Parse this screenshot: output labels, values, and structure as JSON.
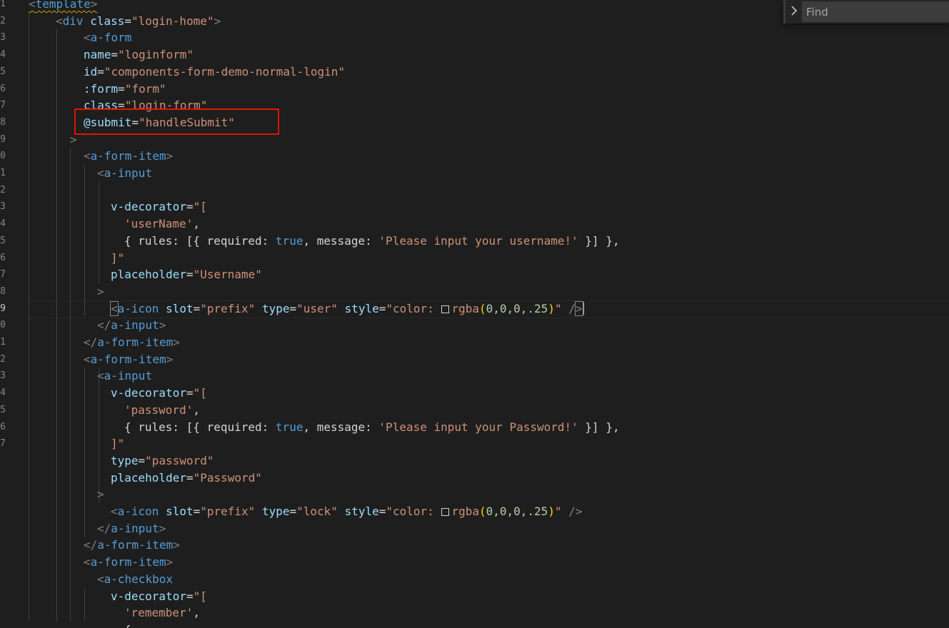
{
  "editor": {
    "gutter_numbers": [
      "1",
      "2",
      "3",
      "4",
      "5",
      "6",
      "7",
      "8",
      "9",
      "0",
      "1",
      "2",
      "3",
      "4",
      "5",
      "6",
      "7",
      "8",
      "9",
      "0",
      "1",
      "2",
      "3",
      "4",
      "5",
      "6",
      "7"
    ],
    "active_line_index": 18
  },
  "find_widget": {
    "placeholder": "Find",
    "toggle_icon": "chevron-right-icon"
  },
  "highlight": {
    "color": "#e51400",
    "target_line_index": 7
  },
  "code_lines": [
    [
      [
        "t-punc squiggle",
        "<"
      ],
      [
        "t-tag squiggle",
        "template"
      ],
      [
        "t-punc squiggle",
        ">"
      ]
    ],
    [
      [
        "t-punc",
        "<"
      ],
      [
        "t-tag",
        "div"
      ],
      [
        "t-txt",
        " "
      ],
      [
        "t-attr",
        "class"
      ],
      [
        "t-txt",
        "="
      ],
      [
        "t-str",
        "\"login-home\""
      ],
      [
        "t-punc",
        ">"
      ]
    ],
    [
      [
        "t-punc",
        "<"
      ],
      [
        "t-tag",
        "a-form"
      ]
    ],
    [
      [
        "t-attr",
        "name"
      ],
      [
        "t-txt",
        "="
      ],
      [
        "t-str",
        "\"loginform\""
      ]
    ],
    [
      [
        "t-attr",
        "id"
      ],
      [
        "t-txt",
        "="
      ],
      [
        "t-str",
        "\"components-form-demo-normal-login\""
      ]
    ],
    [
      [
        "t-attr",
        ":form"
      ],
      [
        "t-txt",
        "="
      ],
      [
        "t-str",
        "\"form\""
      ]
    ],
    [
      [
        "t-attr",
        "class"
      ],
      [
        "t-txt",
        "="
      ],
      [
        "t-str",
        "\"login-form\""
      ]
    ],
    [
      [
        "t-attr",
        "@submit"
      ],
      [
        "t-txt",
        "="
      ],
      [
        "t-str",
        "\"handleSubmit\""
      ]
    ],
    [
      [
        "t-punc",
        ">"
      ]
    ],
    [
      [
        "t-punc",
        "<"
      ],
      [
        "t-tag",
        "a-form-item"
      ],
      [
        "t-punc",
        ">"
      ]
    ],
    [
      [
        "t-punc",
        "<"
      ],
      [
        "t-tag",
        "a-input"
      ]
    ],
    [],
    [
      [
        "t-attr",
        "v-decorator"
      ],
      [
        "t-txt",
        "="
      ],
      [
        "t-str",
        "\"["
      ]
    ],
    [
      [
        "t-str",
        "'userName'"
      ],
      [
        "t-txt",
        ","
      ]
    ],
    [
      [
        "t-txt",
        "{ rules: [{ required: "
      ],
      [
        "t-bool",
        "true"
      ],
      [
        "t-txt",
        ", message: "
      ],
      [
        "t-str",
        "'Please input your username!'"
      ],
      [
        "t-txt",
        " }] },"
      ]
    ],
    [
      [
        "t-str",
        "]\""
      ]
    ],
    [
      [
        "t-attr",
        "placeholder"
      ],
      [
        "t-txt",
        "="
      ],
      [
        "t-str",
        "\"Username\""
      ]
    ],
    [
      [
        "t-punc",
        ">"
      ]
    ],
    [
      [
        "t-punc bracket-match",
        "<"
      ],
      [
        "t-tag",
        "a-icon"
      ],
      [
        "t-txt",
        " "
      ],
      [
        "t-attr",
        "slot"
      ],
      [
        "t-txt",
        "="
      ],
      [
        "t-str",
        "\"prefix\""
      ],
      [
        "t-txt",
        " "
      ],
      [
        "t-attr",
        "type"
      ],
      [
        "t-txt",
        "="
      ],
      [
        "t-str",
        "\"user\""
      ],
      [
        "t-txt",
        " "
      ],
      [
        "t-attr",
        "style"
      ],
      [
        "t-txt",
        "="
      ],
      [
        "t-str",
        "\"color: "
      ],
      [
        "swatch",
        ""
      ],
      [
        "t-str",
        "rgba"
      ],
      [
        "t-paren",
        "("
      ],
      [
        "t-num",
        "0,0,0,.25"
      ],
      [
        "t-paren",
        ")"
      ],
      [
        "t-str",
        "\""
      ],
      [
        "t-txt",
        " "
      ],
      [
        "t-punc",
        "/"
      ],
      [
        "t-punc bracket-match",
        ">"
      ],
      [
        "cursor",
        ""
      ]
    ],
    [
      [
        "t-punc",
        "</"
      ],
      [
        "t-tag",
        "a-input"
      ],
      [
        "t-punc",
        ">"
      ]
    ],
    [
      [
        "t-punc",
        "</"
      ],
      [
        "t-tag",
        "a-form-item"
      ],
      [
        "t-punc",
        ">"
      ]
    ],
    [
      [
        "t-punc",
        "<"
      ],
      [
        "t-tag",
        "a-form-item"
      ],
      [
        "t-punc",
        ">"
      ]
    ],
    [
      [
        "t-punc",
        "<"
      ],
      [
        "t-tag",
        "a-input"
      ]
    ],
    [
      [
        "t-attr",
        "v-decorator"
      ],
      [
        "t-txt",
        "="
      ],
      [
        "t-str",
        "\"["
      ]
    ],
    [
      [
        "t-str",
        "'password'"
      ],
      [
        "t-txt",
        ","
      ]
    ],
    [
      [
        "t-txt",
        "{ rules: [{ required: "
      ],
      [
        "t-bool",
        "true"
      ],
      [
        "t-txt",
        ", message: "
      ],
      [
        "t-str",
        "'Please input your Password!'"
      ],
      [
        "t-txt",
        " }] },"
      ]
    ],
    [
      [
        "t-str",
        "]\""
      ]
    ],
    [
      [
        "t-attr",
        "type"
      ],
      [
        "t-txt",
        "="
      ],
      [
        "t-str",
        "\"password\""
      ]
    ],
    [
      [
        "t-attr",
        "placeholder"
      ],
      [
        "t-txt",
        "="
      ],
      [
        "t-str",
        "\"Password\""
      ]
    ],
    [
      [
        "t-punc",
        ">"
      ]
    ],
    [
      [
        "t-punc",
        "<"
      ],
      [
        "t-tag",
        "a-icon"
      ],
      [
        "t-txt",
        " "
      ],
      [
        "t-attr",
        "slot"
      ],
      [
        "t-txt",
        "="
      ],
      [
        "t-str",
        "\"prefix\""
      ],
      [
        "t-txt",
        " "
      ],
      [
        "t-attr",
        "type"
      ],
      [
        "t-txt",
        "="
      ],
      [
        "t-str",
        "\"lock\""
      ],
      [
        "t-txt",
        " "
      ],
      [
        "t-attr",
        "style"
      ],
      [
        "t-txt",
        "="
      ],
      [
        "t-str",
        "\"color: "
      ],
      [
        "swatch",
        ""
      ],
      [
        "t-str",
        "rgba"
      ],
      [
        "t-paren",
        "("
      ],
      [
        "t-num",
        "0,0,0,.25"
      ],
      [
        "t-paren",
        ")"
      ],
      [
        "t-str",
        "\""
      ],
      [
        "t-txt",
        " "
      ],
      [
        "t-punc",
        "/>"
      ]
    ],
    [
      [
        "t-punc",
        "</"
      ],
      [
        "t-tag",
        "a-input"
      ],
      [
        "t-punc",
        ">"
      ]
    ],
    [
      [
        "t-punc",
        "</"
      ],
      [
        "t-tag",
        "a-form-item"
      ],
      [
        "t-punc",
        ">"
      ]
    ],
    [
      [
        "t-punc",
        "<"
      ],
      [
        "t-tag",
        "a-form-item"
      ],
      [
        "t-punc",
        ">"
      ]
    ],
    [
      [
        "t-punc",
        "<"
      ],
      [
        "t-tag",
        "a-checkbox"
      ]
    ],
    [
      [
        "t-attr",
        "v-decorator"
      ],
      [
        "t-txt",
        "="
      ],
      [
        "t-str",
        "\"["
      ]
    ],
    [
      [
        "t-str",
        "'remember'"
      ],
      [
        "t-txt",
        ","
      ]
    ],
    [
      [
        "t-txt",
        "{"
      ]
    ]
  ]
}
